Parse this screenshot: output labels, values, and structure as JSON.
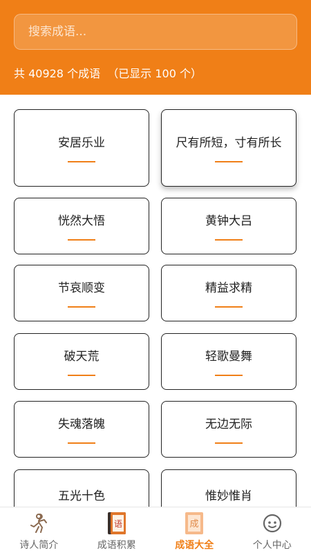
{
  "search": {
    "placeholder": "搜索成语..."
  },
  "count_text": "共 40928 个成语  （已显示 100 个）",
  "idioms": [
    "安居乐业",
    "尺有所短，寸有所长",
    "恍然大悟",
    "黄钟大吕",
    "节哀顺变",
    "精益求精",
    "破天荒",
    "轻歌曼舞",
    "失魂落魄",
    "无边无际",
    "五光十色",
    "惟妙惟肖"
  ],
  "tabs": [
    {
      "label": "诗人简介",
      "icon": "poet-figure-icon"
    },
    {
      "label": "成语积累",
      "icon": "book-icon",
      "glyph": "语"
    },
    {
      "label": "成语大全",
      "icon": "idiom-book-icon",
      "glyph": "成",
      "active": true
    },
    {
      "label": "个人中心",
      "icon": "smiley-face-icon"
    }
  ],
  "colors": {
    "accent": "#f07f17",
    "tab_inactive": "#666666"
  }
}
